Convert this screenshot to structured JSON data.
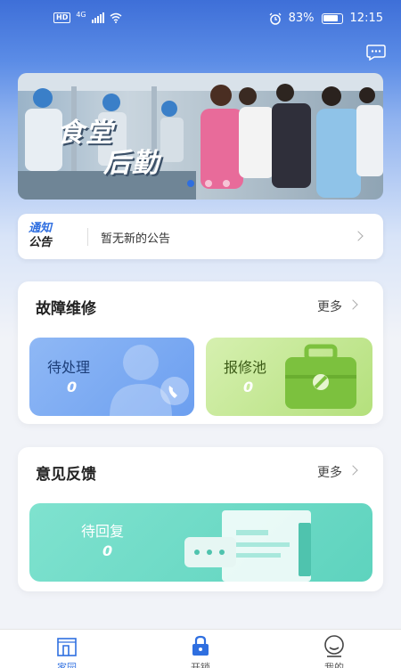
{
  "status_bar": {
    "network": "4G",
    "battery": "83%",
    "time": "12:15"
  },
  "banner": {
    "line1": "食堂",
    "line2": "后勤",
    "slides": 3,
    "active_slide": 0
  },
  "notice": {
    "logo_line1": "通知",
    "logo_line2": "公告",
    "text": "暂无新的公告"
  },
  "repair": {
    "title": "故障维修",
    "more": "更多",
    "pending": {
      "label": "待处理",
      "value": "0"
    },
    "pool": {
      "label": "报修池",
      "value": "0"
    }
  },
  "feedback": {
    "title": "意见反馈",
    "more": "更多",
    "awaiting": {
      "label": "待回复",
      "value": "0"
    }
  },
  "tabbar": {
    "items": [
      {
        "label": "家园",
        "icon": "home-icon",
        "active": true
      },
      {
        "label": "开锁",
        "icon": "lock-icon",
        "active": false
      },
      {
        "label": "我的",
        "icon": "profile-icon",
        "active": false
      }
    ]
  },
  "colors": {
    "primary": "#2f6fe0",
    "pending_tile": "#86b2f2",
    "pool_tile": "#c6e89a",
    "feedback_tile": "#6fdcc8"
  }
}
